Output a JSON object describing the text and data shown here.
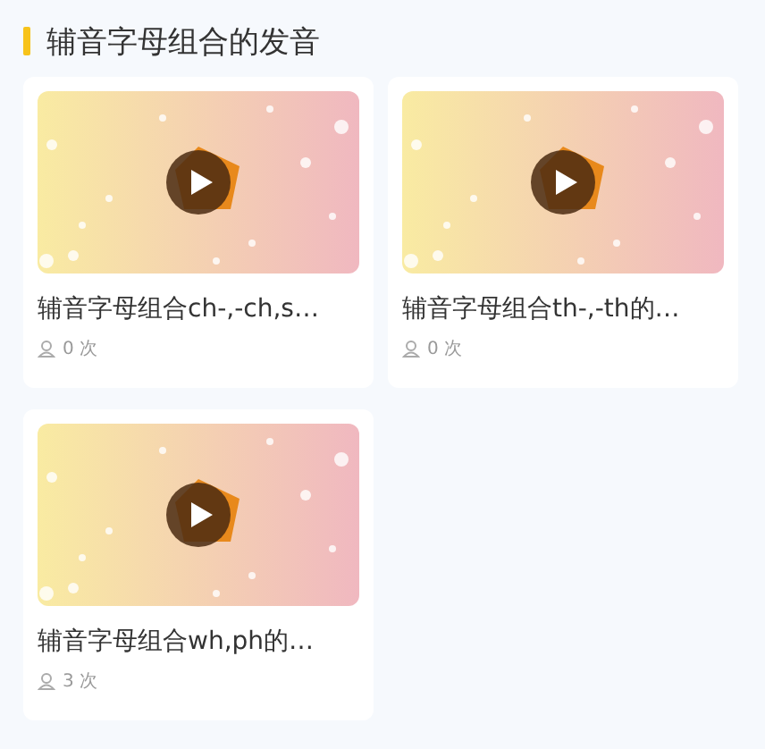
{
  "section": {
    "title": "辅音字母组合的发音"
  },
  "videos": [
    {
      "title": "辅音字母组合ch-,-ch,s…",
      "views": "0 次"
    },
    {
      "title": "辅音字母组合th-,-th的…",
      "views": "0 次"
    },
    {
      "title": "辅音字母组合wh,ph的…",
      "views": "3 次"
    }
  ]
}
